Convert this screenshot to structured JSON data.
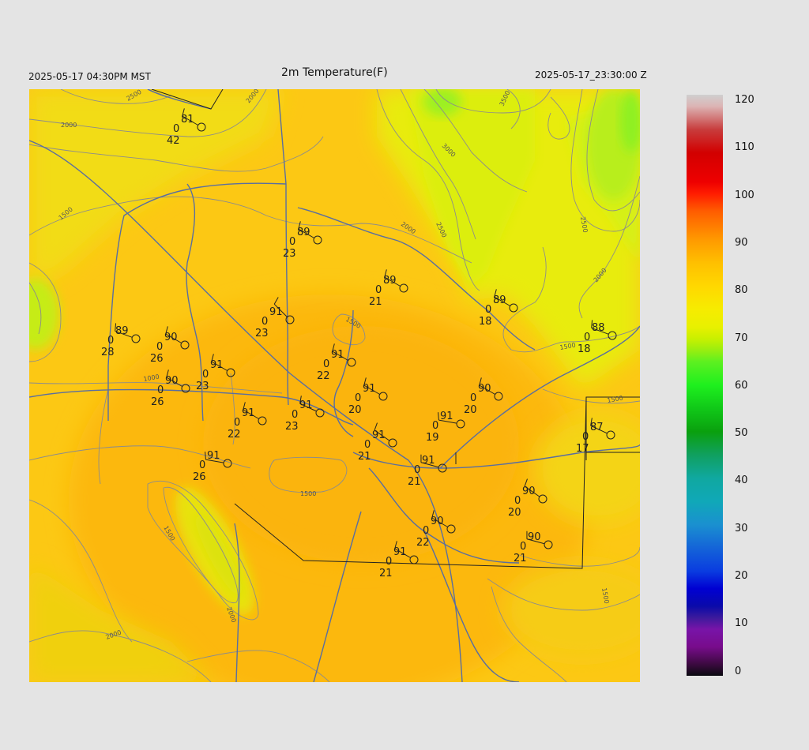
{
  "header": {
    "title": "2m Temperature(F)",
    "local_time": "2025-05-17 04:30PM MST",
    "utc_time": "2025-05-17_23:30:00 Z"
  },
  "colorbar": {
    "labels": [
      "120",
      "110",
      "100",
      "90",
      "80",
      "70",
      "60",
      "50",
      "40",
      "30",
      "20",
      "10",
      "0"
    ]
  },
  "contour_labels": [
    "2500",
    "2000",
    "2000",
    "3500",
    "3000",
    "2500",
    "2000",
    "2500",
    "2000",
    "1500",
    "1500",
    "1000",
    "1500",
    "2000",
    "1500",
    "1500",
    "2000",
    "1500",
    "1500"
  ],
  "stations": [
    {
      "temp": "81",
      "zero": "0",
      "dew": "42"
    },
    {
      "temp": "89",
      "zero": "0",
      "dew": "23"
    },
    {
      "temp": "89",
      "zero": "0",
      "dew": "21"
    },
    {
      "temp": "89",
      "zero": "0",
      "dew": "18"
    },
    {
      "temp": "88",
      "zero": "0",
      "dew": "18"
    },
    {
      "temp": "89",
      "zero": "0",
      "dew": "28"
    },
    {
      "temp": "90",
      "zero": "0",
      "dew": "26"
    },
    {
      "temp": "91",
      "zero": "0",
      "dew": "23"
    },
    {
      "temp": "91",
      "zero": "0",
      "dew": "22"
    },
    {
      "temp": "91",
      "zero": "0",
      "dew": "23"
    },
    {
      "temp": "90",
      "zero": "0",
      "dew": "26"
    },
    {
      "temp": "91",
      "zero": "0",
      "dew": "20"
    },
    {
      "temp": "90",
      "zero": "0",
      "dew": "20"
    },
    {
      "temp": "91",
      "zero": "0",
      "dew": "22"
    },
    {
      "temp": "91",
      "zero": "0",
      "dew": "23"
    },
    {
      "temp": "91",
      "zero": "0",
      "dew": "19"
    },
    {
      "temp": "87",
      "zero": "0",
      "dew": "17"
    },
    {
      "temp": "91",
      "zero": "0",
      "dew": "21"
    },
    {
      "temp": "91",
      "zero": "0",
      "dew": "26"
    },
    {
      "temp": "91",
      "zero": "0",
      "dew": "21"
    },
    {
      "temp": "90",
      "zero": "0",
      "dew": "20"
    },
    {
      "temp": "90",
      "zero": "0",
      "dew": "22"
    },
    {
      "temp": "90",
      "zero": "0",
      "dew": "21"
    },
    {
      "temp": "91",
      "zero": "0",
      "dew": "21"
    }
  ],
  "colors": {
    "background": "#e4e4e4",
    "map_base": "#fcc814",
    "warm_core": "#fcb80c",
    "cool_highland": "#e6ee0a",
    "green_peak": "#96f21e",
    "contour": "#8c8c8c",
    "boundary": "#5a6ea0"
  }
}
